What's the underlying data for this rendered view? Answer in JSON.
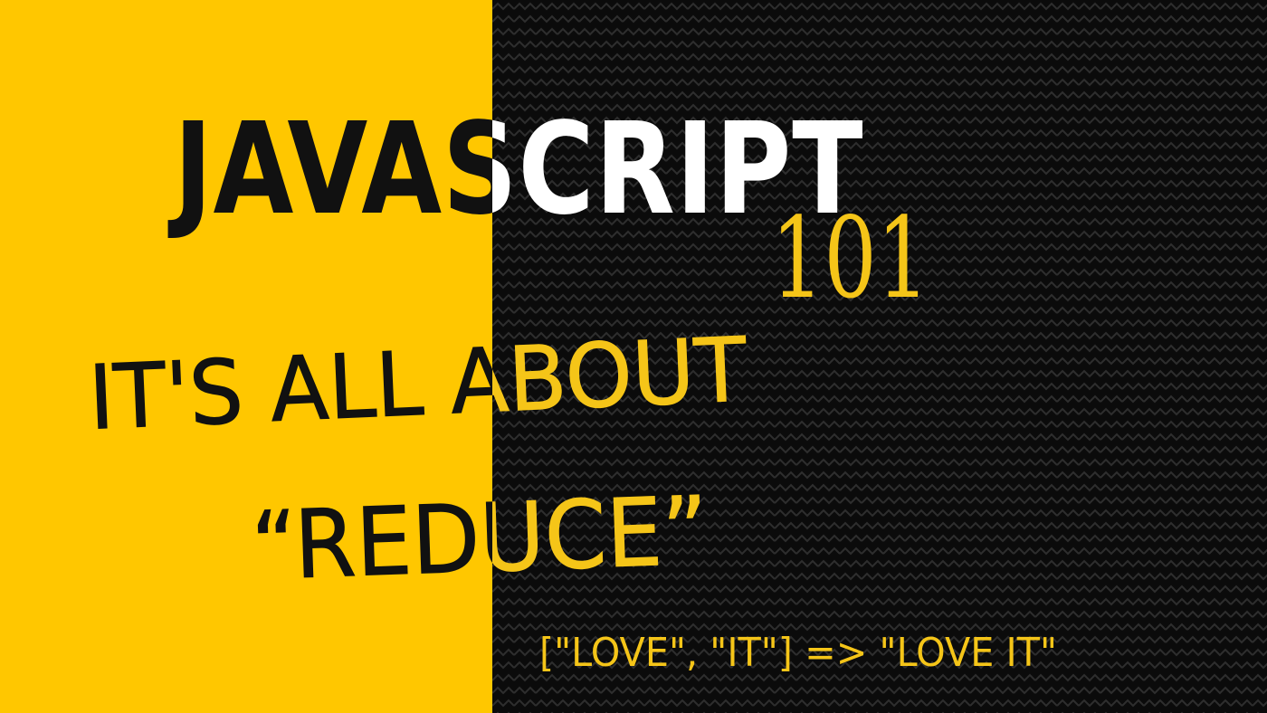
{
  "banner": {
    "title": "JAVASCRIPT",
    "course_number": "101",
    "subtitle": "IT'S ALL ABOUT",
    "keyword": "“REDUCE”",
    "code_example": "[\"LOVE\", \"IT\"] => \"LOVE IT\""
  },
  "colors": {
    "yellow_panel": "#FFC700",
    "dark_panel": "#0B0B0B",
    "zigzag_pattern": "#2E2E2E",
    "text_on_yellow": "#111111",
    "title_on_dark": "#FFFFFF",
    "accent_on_dark": "#F5C518"
  }
}
